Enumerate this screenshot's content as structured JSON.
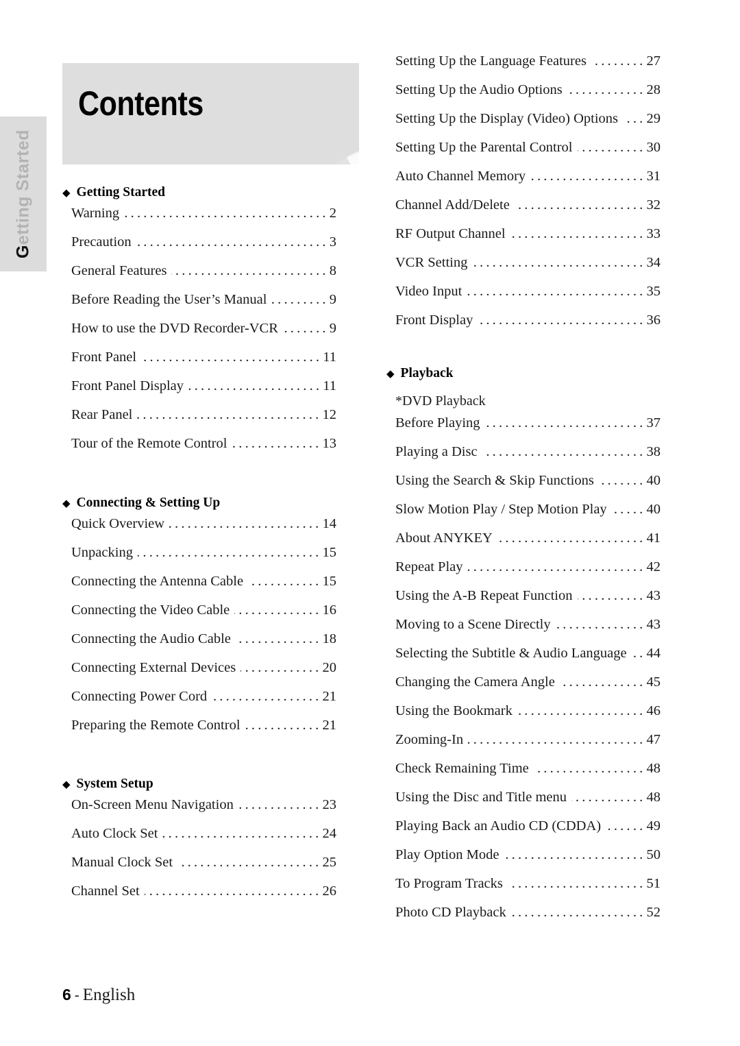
{
  "side_tab": {
    "label": "Getting Started",
    "first_letter": "G",
    "rest": "etting Started",
    "bg_color": "#dcdcdc",
    "text_color": "#b3b3b3"
  },
  "header": {
    "title": "Contents",
    "band_color": "#dedede",
    "disc_icon": "dvd-disc-icon"
  },
  "icons": {
    "diamond": "◆"
  },
  "left_column": [
    {
      "heading": "Getting Started",
      "entries": [
        {
          "title": "Warning",
          "page": "2"
        },
        {
          "title": "Precaution",
          "page": "3"
        },
        {
          "title": "General Features",
          "page": "8"
        },
        {
          "title": "Before Reading the User’s Manual",
          "page": "9"
        },
        {
          "title": "How to use the DVD Recorder-VCR",
          "page": "9"
        },
        {
          "title": "Front Panel",
          "page": "11"
        },
        {
          "title": "Front Panel Display",
          "page": "11"
        },
        {
          "title": "Rear Panel",
          "page": "12"
        },
        {
          "title": "Tour of the Remote Control",
          "page": "13"
        }
      ]
    },
    {
      "heading": "Connecting & Setting Up",
      "entries": [
        {
          "title": "Quick Overview",
          "page": "14"
        },
        {
          "title": "Unpacking",
          "page": "15"
        },
        {
          "title": "Connecting the Antenna Cable",
          "page": "15"
        },
        {
          "title": "Connecting the Video Cable",
          "page": "16"
        },
        {
          "title": "Connecting the Audio Cable",
          "page": "18"
        },
        {
          "title": "Connecting External Devices",
          "page": "20"
        },
        {
          "title": "Connecting Power Cord",
          "page": "21"
        },
        {
          "title": "Preparing the Remote Control",
          "page": "21"
        }
      ]
    },
    {
      "heading": "System Setup",
      "entries": [
        {
          "title": "On-Screen Menu Navigation",
          "page": "23"
        },
        {
          "title": "Auto Clock Set",
          "page": "24"
        },
        {
          "title": "Manual Clock Set",
          "page": "25"
        },
        {
          "title": "Channel Set",
          "page": "26"
        }
      ]
    }
  ],
  "right_column": [
    {
      "heading": null,
      "entries": [
        {
          "title": "Setting Up the Language Features",
          "page": "27"
        },
        {
          "title": "Setting Up the Audio Options",
          "page": "28"
        },
        {
          "title": "Setting Up the Display (Video) Options",
          "page": "29"
        },
        {
          "title": "Setting Up the Parental Control",
          "page": "30"
        },
        {
          "title": "Auto Channel Memory",
          "page": "31"
        },
        {
          "title": "Channel Add/Delete",
          "page": "32"
        },
        {
          "title": "RF Output Channel",
          "page": "33"
        },
        {
          "title": "VCR Setting",
          "page": "34"
        },
        {
          "title": "Video Input",
          "page": "35"
        },
        {
          "title": "Front Display",
          "page": "36"
        }
      ]
    },
    {
      "heading": "Playback",
      "subheading": "*DVD Playback",
      "entries": [
        {
          "title": "Before Playing",
          "page": "37"
        },
        {
          "title": "Playing a Disc",
          "page": "38"
        },
        {
          "title": "Using the Search & Skip Functions",
          "page": "40"
        },
        {
          "title": "Slow Motion Play / Step Motion Play",
          "page": "40"
        },
        {
          "title": "About ANYKEY",
          "page": "41"
        },
        {
          "title": "Repeat Play",
          "page": "42"
        },
        {
          "title": "Using the A-B Repeat Function",
          "page": "43"
        },
        {
          "title": "Moving to a Scene Directly",
          "page": "43"
        },
        {
          "title": "Selecting the Subtitle & Audio Language",
          "page": "44"
        },
        {
          "title": "Changing the Camera Angle",
          "page": "45"
        },
        {
          "title": "Using the Bookmark",
          "page": "46"
        },
        {
          "title": "Zooming-In",
          "page": "47"
        },
        {
          "title": "Check Remaining Time",
          "page": "48"
        },
        {
          "title": "Using the Disc and Title menu",
          "page": "48"
        },
        {
          "title": "Playing Back an Audio CD (CDDA)",
          "page": "49"
        },
        {
          "title": "Play Option Mode",
          "page": "50"
        },
        {
          "title": "To Program Tracks",
          "page": "51"
        },
        {
          "title": "Photo CD Playback",
          "page": "52"
        }
      ]
    }
  ],
  "footer": {
    "page_number": "6",
    "separator": "-",
    "language": "English"
  }
}
